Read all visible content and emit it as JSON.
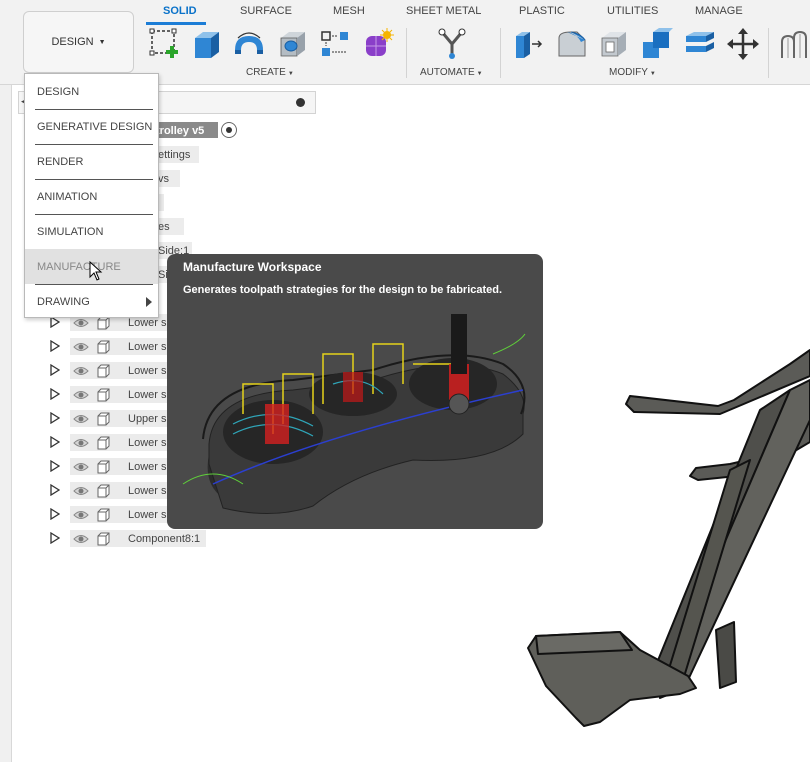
{
  "workspace_button": {
    "label": "DESIGN"
  },
  "tabs": [
    {
      "label": "SOLID",
      "active": true
    },
    {
      "label": "SURFACE"
    },
    {
      "label": "MESH"
    },
    {
      "label": "SHEET METAL"
    },
    {
      "label": "PLASTIC"
    },
    {
      "label": "UTILITIES"
    },
    {
      "label": "MANAGE"
    }
  ],
  "groups": {
    "create": "CREATE",
    "automate": "AUTOMATE",
    "modify": "MODIFY"
  },
  "toolbar_icons": [
    "create-sketch-icon",
    "extrude-icon",
    "revolve-icon",
    "hole-icon",
    "pattern-icon",
    "form-icon",
    "automate-icon",
    "press-pull-icon",
    "fillet-icon",
    "shell-icon",
    "combine-icon",
    "align-icon",
    "move-icon",
    "inspect-icon"
  ],
  "browser": {
    "document_name": "trolley v5",
    "fragments": {
      "settings": "ettings",
      "views": "vs",
      "bodies": "es",
      "side": "Side:1",
      "sid": "Sid"
    }
  },
  "tree_rows": [
    {
      "label": "Lower s"
    },
    {
      "label": "Lower s"
    },
    {
      "label": "Lower s"
    },
    {
      "label": "Lower s"
    },
    {
      "label": "Upper s"
    },
    {
      "label": "Lower s"
    },
    {
      "label": "Lower s"
    },
    {
      "label": "Lower s"
    },
    {
      "label": "Lower s"
    },
    {
      "label": "Component8:1"
    }
  ],
  "workspace_menu": [
    {
      "label": "DESIGN"
    },
    {
      "label": "GENERATIVE DESIGN"
    },
    {
      "label": "RENDER"
    },
    {
      "label": "ANIMATION"
    },
    {
      "label": "SIMULATION"
    },
    {
      "label": "MANUFACTURE",
      "hovered": true
    },
    {
      "label": "DRAWING",
      "submenu": true
    }
  ],
  "tooltip": {
    "title": "Manufacture Workspace",
    "description": "Generates toolpath strategies for the design to be fabricated."
  },
  "colors": {
    "accent": "#1c7dd6",
    "tooltip_bg": "#4a4a4a",
    "model": "#5b5b57"
  }
}
